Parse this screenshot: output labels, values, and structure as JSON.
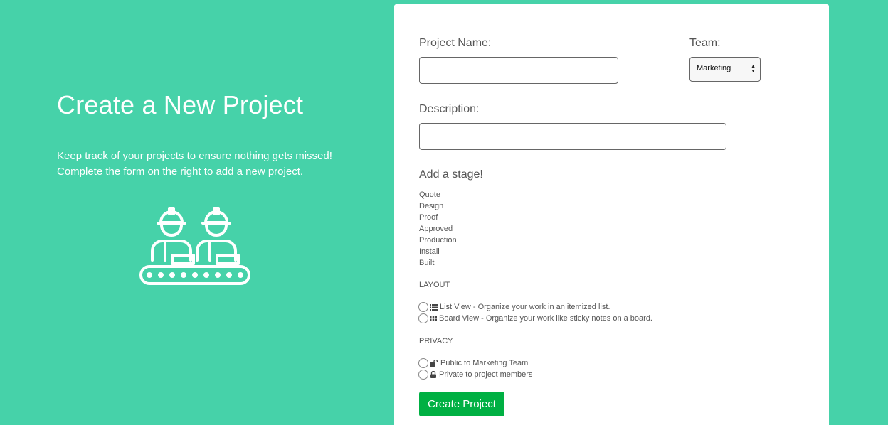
{
  "hero": {
    "title": "Create a New Project",
    "line1": "Keep track of your projects to ensure nothing gets missed!",
    "line2": "Complete the form on the right to add a new project."
  },
  "form": {
    "project_name_label": "Project Name:",
    "project_name_value": "",
    "team_label": "Team:",
    "team_selected": "Marketing",
    "description_label": "Description:",
    "description_value": "",
    "stage_title": "Add a stage!",
    "stages": [
      "Quote",
      "Design",
      "Proof",
      "Approved",
      "Production",
      "Install",
      "Built"
    ],
    "layout_heading": "LAYOUT",
    "layout_options": [
      {
        "label": "List View - Organize your work in an itemized list.",
        "icon": "list-icon"
      },
      {
        "label": "Board View - Organize your work like sticky notes on a board.",
        "icon": "grid-icon"
      }
    ],
    "privacy_heading": "PRIVACY",
    "privacy_options": [
      {
        "label": "Public to Marketing Team",
        "icon": "unlock-icon"
      },
      {
        "label": "Private to project members",
        "icon": "lock-icon"
      }
    ],
    "submit_label": "Create Project"
  },
  "colors": {
    "background": "#46d2a9",
    "button": "#00b043"
  }
}
